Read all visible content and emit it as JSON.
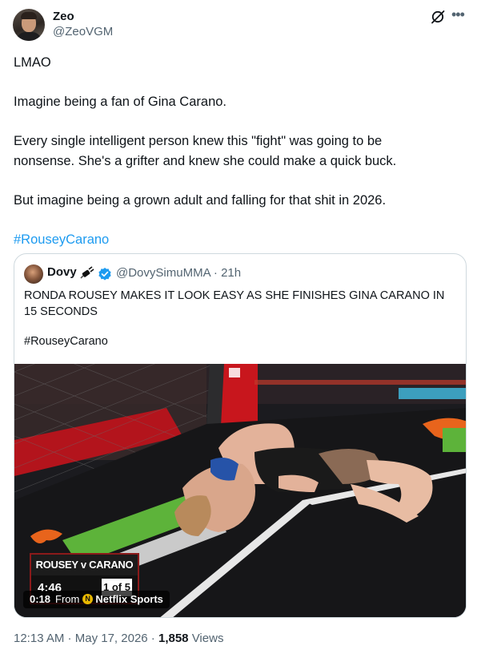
{
  "author": {
    "name": "Zeo",
    "handle": "@ZeoVGM"
  },
  "tweet": {
    "lines": [
      "LMAO",
      "Imagine being a fan of Gina Carano.",
      "Every single intelligent person knew this \"fight\" was going to be",
      "nonsense. She's a grifter and knew she could make a quick buck.",
      "But imagine being a grown adult and falling for that shit in 2026."
    ],
    "hashtag": "#RouseyCarano"
  },
  "quote": {
    "name": "Dovy",
    "handle": "@DovySimuMMA",
    "time": "21h",
    "text": "RONDA ROUSEY MAKES IT LOOK EASY AS SHE FINISHES GINA CARANO IN 15 SECONDS",
    "hashtag": "#RouseyCarano",
    "media": {
      "scorebug_title": "ROUSEY v CARANO",
      "clock": "4:46",
      "round": "1 of 5",
      "duration": "0:18",
      "from_label": "From",
      "source": "Netflix Sports"
    }
  },
  "meta": {
    "time": "12:13 AM",
    "date": "May 17, 2026",
    "views": "1,858",
    "views_label": "Views"
  },
  "colors": {
    "link": "#1d9bf0",
    "muted": "#536471",
    "verified": "#1d9bf0",
    "border": "#cfd9de"
  },
  "icons": [
    "grok-icon",
    "more-icon",
    "verified-icon",
    "netflix-icon"
  ]
}
